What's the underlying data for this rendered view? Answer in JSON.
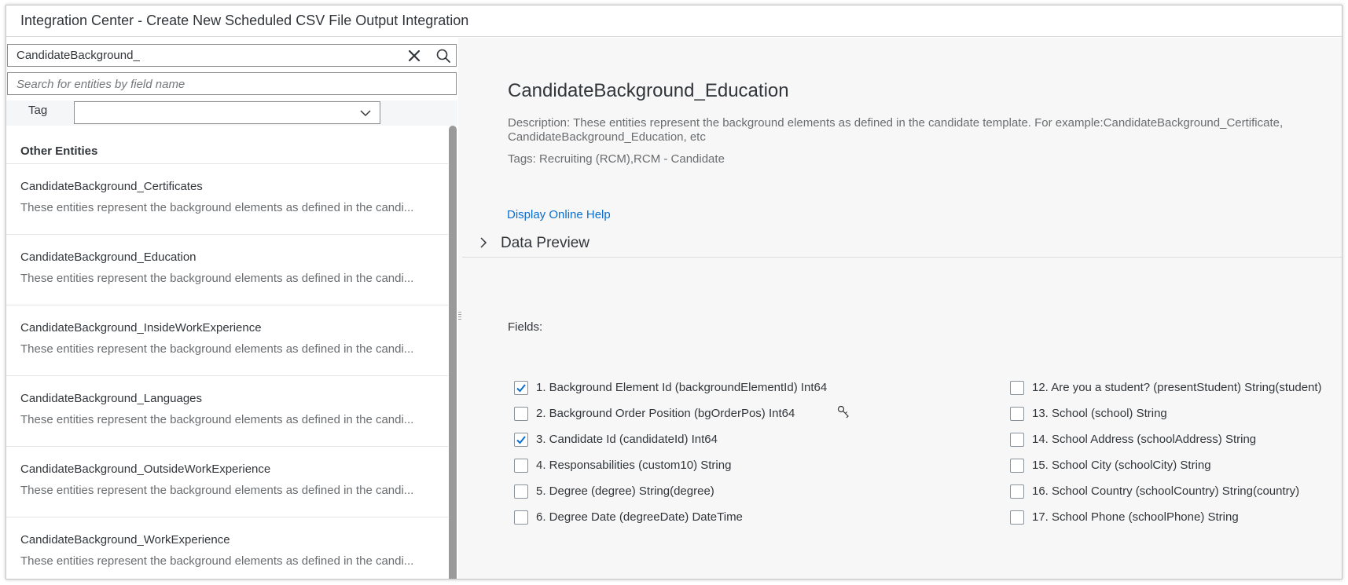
{
  "window": {
    "title": "Integration Center - Create New Scheduled CSV File Output Integration"
  },
  "left": {
    "search": {
      "value": "CandidateBackground_"
    },
    "field_search": {
      "placeholder": "Search for entities by field name"
    },
    "tag": {
      "label": "Tag",
      "value": ""
    },
    "group_header": "Other Entities",
    "entities": [
      {
        "name": "CandidateBackground_Certificates",
        "desc": "These entities represent the background elements as defined in the candi..."
      },
      {
        "name": "CandidateBackground_Education",
        "desc": "These entities represent the background elements as defined in the candi..."
      },
      {
        "name": "CandidateBackground_InsideWorkExperience",
        "desc": "These entities represent the background elements as defined in the candi..."
      },
      {
        "name": "CandidateBackground_Languages",
        "desc": "These entities represent the background elements as defined in the candi..."
      },
      {
        "name": "CandidateBackground_OutsideWorkExperience",
        "desc": "These entities represent the background elements as defined in the candi..."
      },
      {
        "name": "CandidateBackground_WorkExperience",
        "desc": "These entities represent the background elements as defined in the candi..."
      }
    ]
  },
  "right": {
    "title": "CandidateBackground_Education",
    "description": "Description: These entities represent the background elements as defined in the candidate template. For example:CandidateBackground_Certificate, CandidateBackground_Education, etc",
    "tags": "Tags: Recruiting (RCM),RCM - Candidate",
    "help_link": "Display Online Help",
    "data_preview": "Data Preview",
    "fields_label": "Fields:",
    "fields_left": [
      {
        "label": "1. Background Element Id (backgroundElementId) Int64",
        "checked": true
      },
      {
        "label": "2. Background Order Position (bgOrderPos) Int64",
        "checked": false
      },
      {
        "label": "3. Candidate Id (candidateId) Int64",
        "checked": true
      },
      {
        "label": "4. Responsabilities (custom10) String",
        "checked": false
      },
      {
        "label": "5. Degree (degree) String(degree)",
        "checked": false
      },
      {
        "label": "6. Degree Date (degreeDate) DateTime",
        "checked": false
      }
    ],
    "fields_right": [
      {
        "label": "12. Are you a student? (presentStudent) String(student)",
        "checked": false
      },
      {
        "label": "13. School (school) String",
        "checked": false
      },
      {
        "label": "14. School Address (schoolAddress) String",
        "checked": false
      },
      {
        "label": "15. School City (schoolCity) String",
        "checked": false
      },
      {
        "label": "16. School Country (schoolCountry) String(country)",
        "checked": false
      },
      {
        "label": "17. School Phone (schoolPhone) String",
        "checked": false
      }
    ]
  },
  "colors": {
    "link": "#0a6ed1",
    "checkmark": "#0a6ed1",
    "scrollbar": "#9a9a9a"
  }
}
